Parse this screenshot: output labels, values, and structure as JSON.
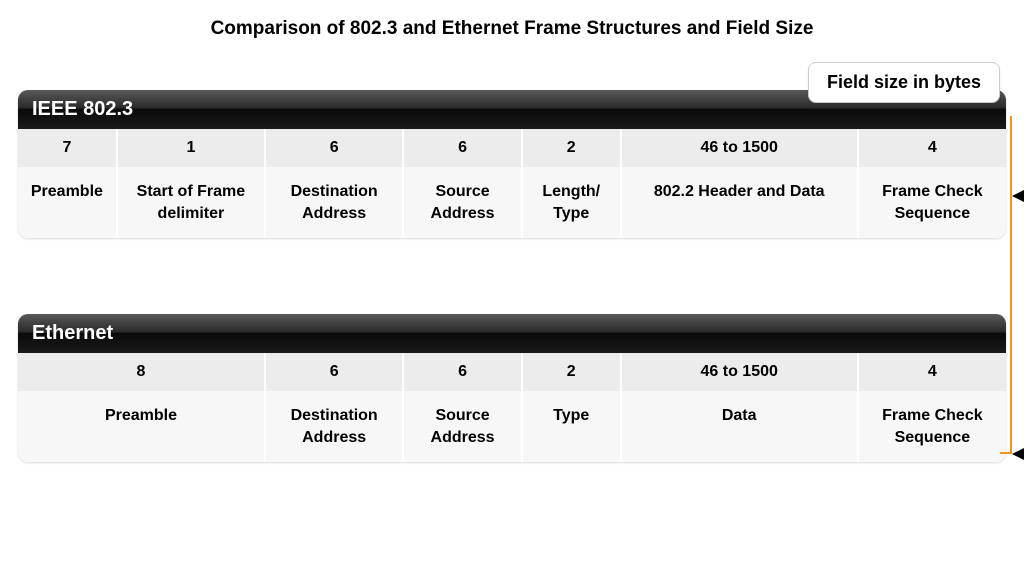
{
  "title": "Comparison of 802.3 and Ethernet Frame Structures and Field Size",
  "callout": "Field size in bytes",
  "frames": [
    {
      "header": "IEEE 802.3",
      "fields": [
        {
          "size": "7",
          "name": "Preamble"
        },
        {
          "size": "1",
          "name": "Start of Frame delimiter"
        },
        {
          "size": "6",
          "name": "Destination Address"
        },
        {
          "size": "6",
          "name": "Source Address"
        },
        {
          "size": "2",
          "name": "Length/ Type"
        },
        {
          "size": "46 to 1500",
          "name": "802.2 Header and Data"
        },
        {
          "size": "4",
          "name": "Frame Check Sequence"
        }
      ]
    },
    {
      "header": "Ethernet",
      "fields": [
        {
          "size": "8",
          "name": "Preamble",
          "span": 2
        },
        {
          "size": "6",
          "name": "Destination Address",
          "span": 1
        },
        {
          "size": "6",
          "name": "Source Address",
          "span": 1
        },
        {
          "size": "2",
          "name": "Type",
          "span": 1
        },
        {
          "size": "46 to 1500",
          "name": "Data",
          "span": 1
        },
        {
          "size": "4",
          "name": "Frame Check Sequence",
          "span": 1
        }
      ]
    }
  ],
  "chart_data": {
    "type": "table",
    "title": "Comparison of 802.3 and Ethernet Frame Structures and Field Size",
    "unit": "bytes",
    "series": [
      {
        "name": "IEEE 802.3",
        "fields": [
          {
            "name": "Preamble",
            "size_bytes": "7"
          },
          {
            "name": "Start of Frame delimiter",
            "size_bytes": "1"
          },
          {
            "name": "Destination Address",
            "size_bytes": "6"
          },
          {
            "name": "Source Address",
            "size_bytes": "6"
          },
          {
            "name": "Length/Type",
            "size_bytes": "2"
          },
          {
            "name": "802.2 Header and Data",
            "size_bytes": "46 to 1500"
          },
          {
            "name": "Frame Check Sequence",
            "size_bytes": "4"
          }
        ]
      },
      {
        "name": "Ethernet",
        "fields": [
          {
            "name": "Preamble",
            "size_bytes": "8"
          },
          {
            "name": "Destination Address",
            "size_bytes": "6"
          },
          {
            "name": "Source Address",
            "size_bytes": "6"
          },
          {
            "name": "Type",
            "size_bytes": "2"
          },
          {
            "name": "Data",
            "size_bytes": "46 to 1500"
          },
          {
            "name": "Frame Check Sequence",
            "size_bytes": "4"
          }
        ]
      }
    ]
  }
}
